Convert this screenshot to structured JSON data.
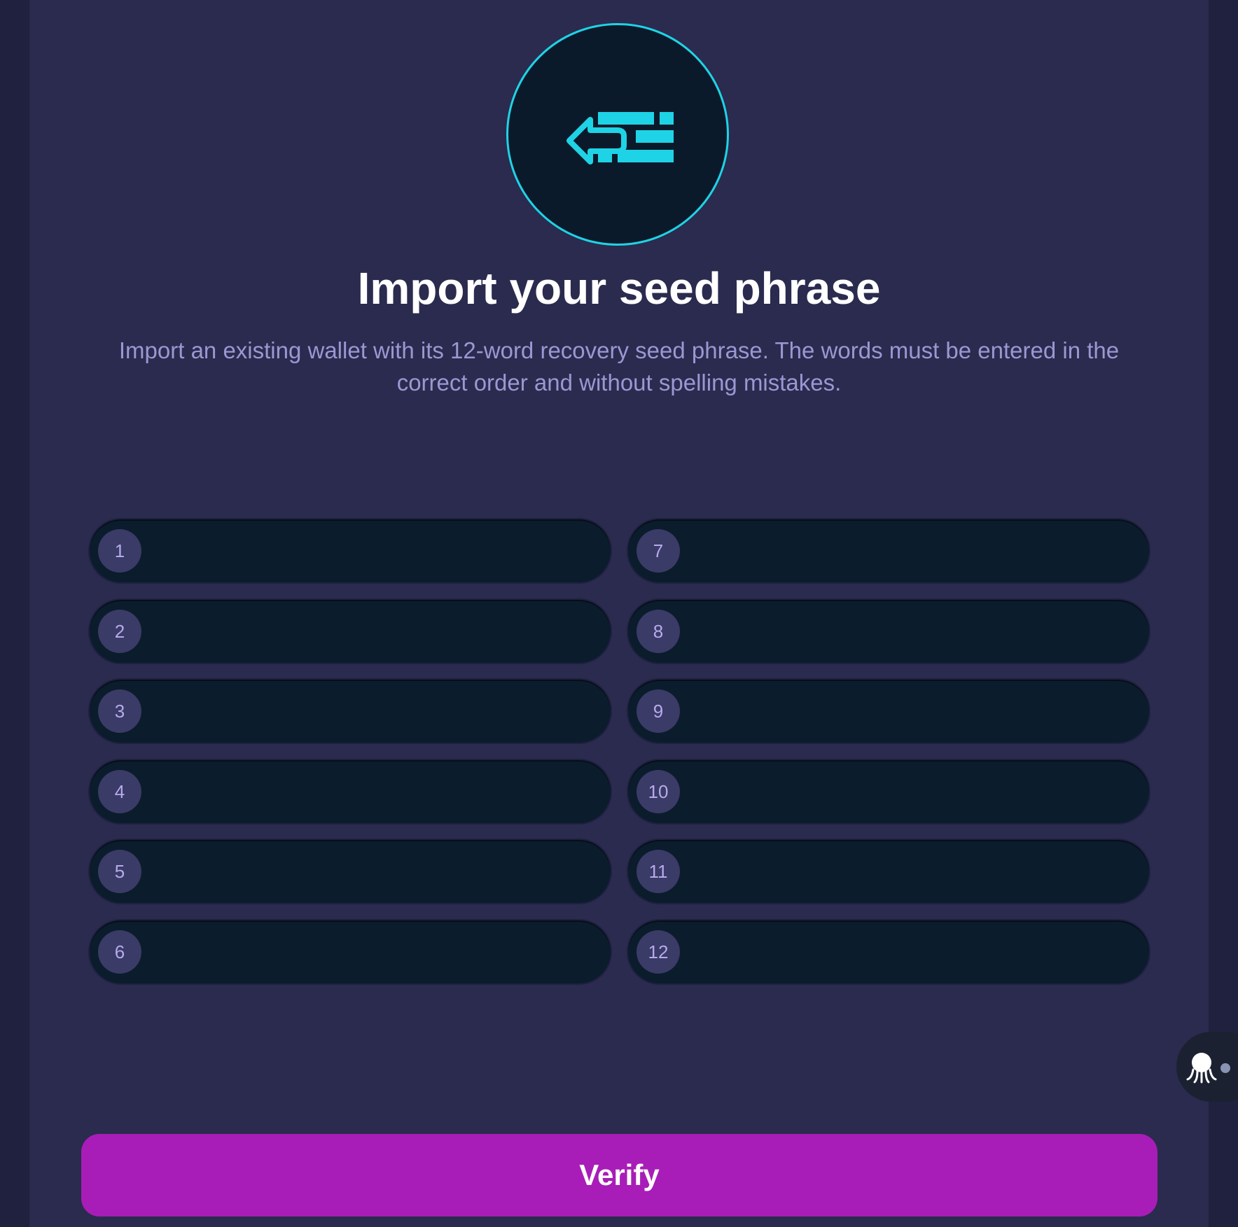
{
  "header": {
    "title": "Import your seed phrase",
    "description": "Import an existing wallet with its 12-word recovery seed phrase. The words must be entered in the correct order and without spelling mistakes.",
    "icon": "import-arrow-icon"
  },
  "seed_words": [
    {
      "number": "1",
      "value": ""
    },
    {
      "number": "2",
      "value": ""
    },
    {
      "number": "3",
      "value": ""
    },
    {
      "number": "4",
      "value": ""
    },
    {
      "number": "5",
      "value": ""
    },
    {
      "number": "6",
      "value": ""
    },
    {
      "number": "7",
      "value": ""
    },
    {
      "number": "8",
      "value": ""
    },
    {
      "number": "9",
      "value": ""
    },
    {
      "number": "10",
      "value": ""
    },
    {
      "number": "11",
      "value": ""
    },
    {
      "number": "12",
      "value": ""
    }
  ],
  "actions": {
    "verify_label": "Verify"
  },
  "support_widget": {
    "icon": "octopus-icon"
  },
  "colors": {
    "accent": "#1fd3e6",
    "button": "#a81db7",
    "background": "#2a2b4e",
    "field": "#0b1c2c"
  }
}
